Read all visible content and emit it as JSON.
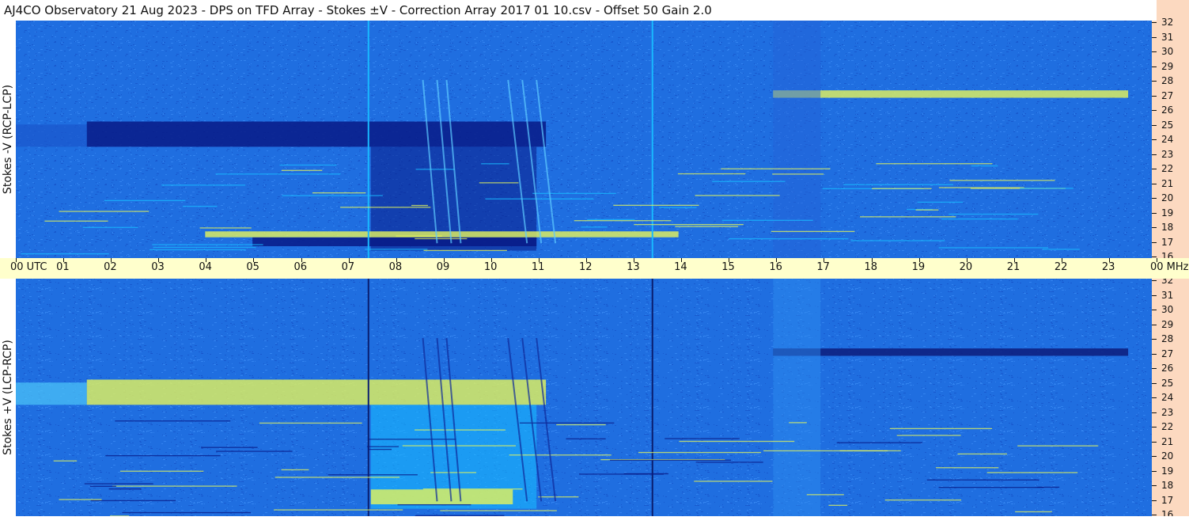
{
  "title": "AJ4CO Observatory  21 Aug 2023  -  DPS on TFD Array  -  Stokes ±V  -  Correction Array 2017 01 10.csv  -  Offset 50  Gain 2.0",
  "colors": {
    "background": "#1f6ee0",
    "dark": "#081a86",
    "cyan": "#19b9ff",
    "yellow": "#e6f55a",
    "time_axis": "#ffffcc",
    "freq_axis": "#fcd9c0"
  },
  "panels": [
    {
      "id": "neg",
      "label": "Stokes -V  (RCP-LCP)"
    },
    {
      "id": "pos",
      "label": "Stokes +V  (LCP-RCP)"
    }
  ],
  "time_axis": {
    "ticks": [
      "00  UTC",
      "01",
      "02",
      "03",
      "04",
      "05",
      "06",
      "07",
      "08",
      "09",
      "10",
      "11",
      "12",
      "13",
      "14",
      "15",
      "16",
      "17",
      "18",
      "19",
      "20",
      "21",
      "22",
      "23",
      "00 MHz"
    ]
  },
  "freq_axis": {
    "ticks": [
      "32",
      "31",
      "30",
      "29",
      "28",
      "27",
      "26",
      "25",
      "24",
      "23",
      "22",
      "21",
      "20",
      "19",
      "18",
      "17",
      "16"
    ]
  },
  "chart_data": [
    {
      "type": "heatmap",
      "title": "Stokes -V  (RCP-LCP)",
      "x_unit": "UTC hour",
      "y_unit": "MHz",
      "xlim": [
        0,
        24
      ],
      "ylim": [
        16,
        32
      ],
      "features": [
        {
          "kind": "dark_band",
          "t_start": 1.5,
          "t_end": 11.2,
          "f_low": 23.5,
          "f_high": 25.2
        },
        {
          "kind": "dark_region",
          "t_start": 7.5,
          "t_end": 11.0,
          "f_low": 16.5,
          "f_high": 23.5
        },
        {
          "kind": "dark_band",
          "t_start": 5.0,
          "t_end": 11.0,
          "f_low": 16.8,
          "f_high": 17.4
        },
        {
          "kind": "bright_band",
          "t_start": 16.0,
          "t_end": 23.5,
          "f_low": 26.8,
          "f_high": 27.3
        },
        {
          "kind": "bright_band",
          "t_start": 4.0,
          "t_end": 14.0,
          "f_low": 17.4,
          "f_high": 17.8
        },
        {
          "kind": "vertical_line",
          "t": 7.45
        },
        {
          "kind": "vertical_line",
          "t": 13.45
        }
      ]
    },
    {
      "type": "heatmap",
      "title": "Stokes +V  (LCP-RCP)",
      "x_unit": "UTC hour",
      "y_unit": "MHz",
      "xlim": [
        0,
        24
      ],
      "ylim": [
        16,
        32
      ],
      "features": [
        {
          "kind": "bright_band",
          "t_start": 1.5,
          "t_end": 11.2,
          "f_low": 23.5,
          "f_high": 25.2
        },
        {
          "kind": "bright_region",
          "t_start": 7.5,
          "t_end": 11.0,
          "f_low": 16.5,
          "f_high": 23.5
        },
        {
          "kind": "bright_band",
          "t_start": 7.5,
          "t_end": 10.5,
          "f_low": 16.8,
          "f_high": 17.8
        },
        {
          "kind": "dark_band",
          "t_start": 16.0,
          "t_end": 23.5,
          "f_low": 26.8,
          "f_high": 27.3
        },
        {
          "kind": "vertical_line",
          "t": 7.45
        },
        {
          "kind": "vertical_line",
          "t": 13.45
        }
      ]
    }
  ]
}
